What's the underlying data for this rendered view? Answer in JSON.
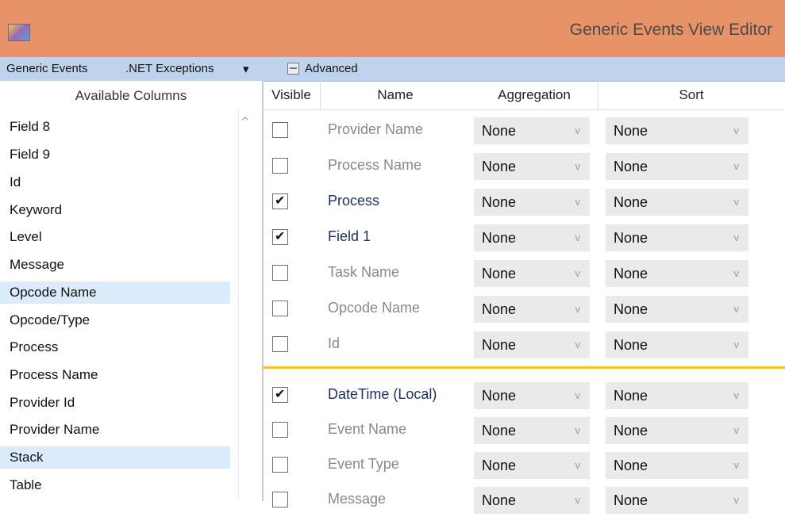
{
  "title": "Generic Events View Editor",
  "toolbar": {
    "generic_events": "Generic Events",
    "net_exceptions": ".NET Exceptions",
    "dropdown_arrow": "▾",
    "advanced": "Advanced"
  },
  "left_panel": {
    "header": "Available Columns",
    "items": [
      "Field 8",
      "Field 9",
      "Id",
      "Keyword",
      "Level",
      "Message",
      "Opcode Name",
      "Opcode/Type",
      "Process",
      "Process Name",
      "Provider Id",
      "Provider Name",
      "Stack",
      "Table"
    ]
  },
  "columns": {
    "visible": "Visible",
    "name": "Name",
    "aggregation": "Aggregation",
    "sort": "Sort"
  },
  "rows": [
    {
      "name": "Provider Name",
      "visible": false,
      "aggregation": "None",
      "sort": "None"
    },
    {
      "name": "Process Name",
      "visible": false,
      "aggregation": "None",
      "sort": "None"
    },
    {
      "name": "Process",
      "visible": true,
      "aggregation": "None",
      "sort": "None"
    },
    {
      "name": "Field 1",
      "visible": true,
      "aggregation": "None",
      "sort": "None"
    },
    {
      "name": "Task Name",
      "visible": false,
      "aggregation": "None",
      "sort": "None"
    },
    {
      "name": "Opcode Name",
      "visible": false,
      "aggregation": "None",
      "sort": "None"
    },
    {
      "name": "Id",
      "visible": false,
      "aggregation": "None",
      "sort": "None"
    },
    {
      "name": "DateTime (Local)",
      "visible": true,
      "aggregation": "None",
      "sort": "None"
    },
    {
      "name": "Event Name",
      "visible": false,
      "aggregation": "None",
      "sort": "None"
    },
    {
      "name": "Event Type",
      "visible": false,
      "aggregation": "None",
      "sort": "None"
    },
    {
      "name": "Message",
      "visible": false,
      "aggregation": "None",
      "sort": "None"
    }
  ],
  "icons": {
    "app": "app-icon",
    "advanced": "advanced-icon",
    "chevron": "chevron-down-icon"
  },
  "colors": {
    "titlebar": "#e89268",
    "toolbar": "#bfd4ec",
    "separator": "#f2c230",
    "selection": "#dcebfa"
  }
}
